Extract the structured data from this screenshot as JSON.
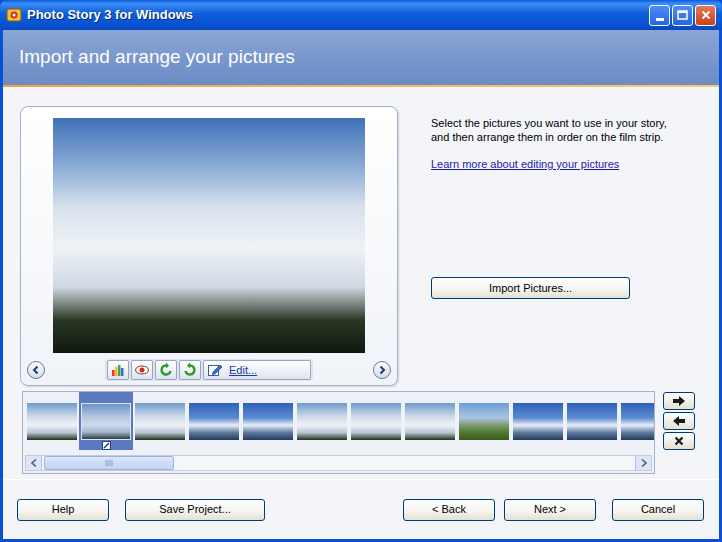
{
  "window": {
    "title": "Photo Story 3 for Windows"
  },
  "header": {
    "title": "Import and arrange your pictures"
  },
  "instructions": "Select the pictures you want to use in your story, and then arrange them in order on the film strip.",
  "help_link": "Learn more about editing your pictures",
  "import_button": "Import Pictures...",
  "edit_button": "Edit...",
  "filmstrip": {
    "thumbnails": [
      {
        "kind": "snow",
        "selected": false
      },
      {
        "kind": "snow",
        "selected": true
      },
      {
        "kind": "snow",
        "selected": false
      },
      {
        "kind": "range",
        "selected": false
      },
      {
        "kind": "range",
        "selected": false
      },
      {
        "kind": "snow",
        "selected": false
      },
      {
        "kind": "snow",
        "selected": false
      },
      {
        "kind": "snow",
        "selected": false
      },
      {
        "kind": "meadow",
        "selected": false
      },
      {
        "kind": "range",
        "selected": false
      },
      {
        "kind": "range",
        "selected": false
      },
      {
        "kind": "range",
        "selected": false
      }
    ],
    "scrollbar": {
      "level": 0.22
    }
  },
  "footer": {
    "left_buttons": [
      "Help",
      "Save Project..."
    ],
    "right_buttons": [
      "< Back",
      "Next >",
      "Cancel"
    ]
  }
}
